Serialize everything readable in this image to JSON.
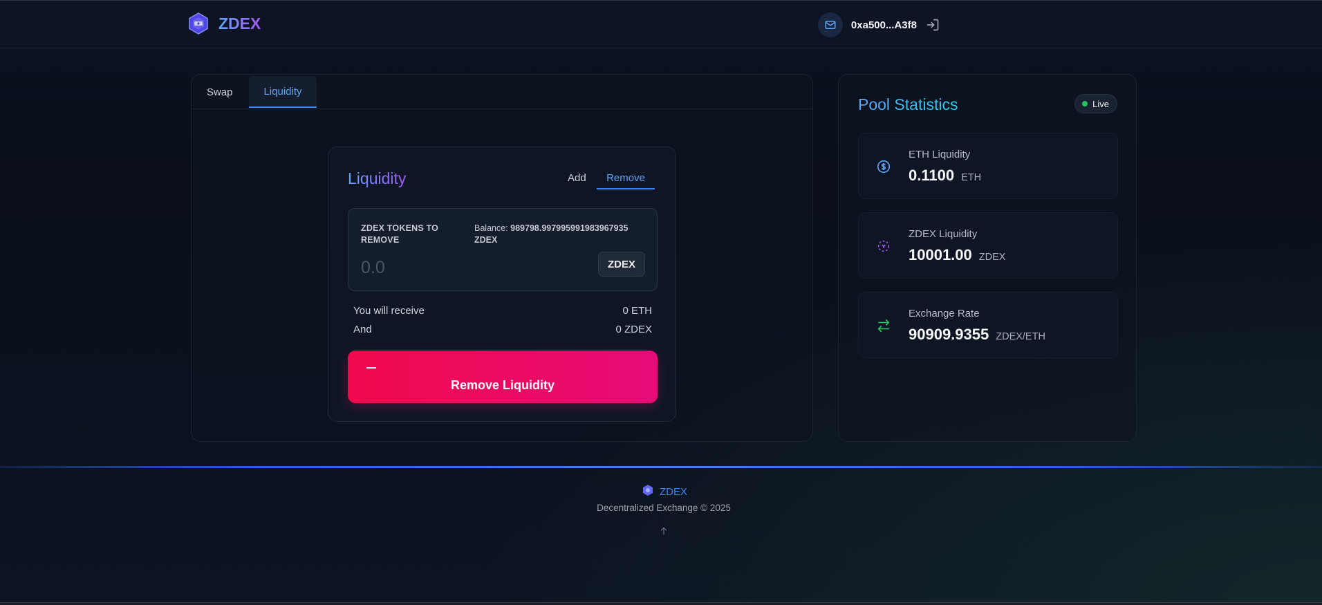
{
  "header": {
    "brand": "ZDEX",
    "wallet_address": "0xa500...A3f8",
    "icons": {
      "logo": "zdex-logo-icon",
      "wallet": "mail-icon",
      "logout": "logout-icon"
    }
  },
  "tabs": [
    {
      "label": "Swap",
      "active": false
    },
    {
      "label": "Liquidity",
      "active": true
    }
  ],
  "liquidity": {
    "title": "Liquidity",
    "mode_add": "Add",
    "mode_remove": "Remove",
    "active_mode": "Remove",
    "input": {
      "label": "ZDEX TOKENS TO REMOVE",
      "balance_prefix": "Balance:",
      "balance_value": "989798.997995991983967935",
      "balance_unit": "ZDEX",
      "placeholder": "0.0",
      "value": "",
      "token": "ZDEX"
    },
    "receive_label": "You will receive",
    "receive_eth": "0 ETH",
    "and_label": "And",
    "receive_zdex": "0 ZDEX",
    "button_label": "Remove Liquidity"
  },
  "stats": {
    "title": "Pool Statistics",
    "live_label": "Live",
    "items": [
      {
        "label": "ETH Liquidity",
        "value": "0.1100",
        "unit": "ETH",
        "icon": "dollar-circle-icon",
        "color": "#60a5fa"
      },
      {
        "label": "ZDEX Liquidity",
        "value": "10001.00",
        "unit": "ZDEX",
        "icon": "token-circle-icon",
        "color": "#a855f7"
      },
      {
        "label": "Exchange Rate",
        "value": "90909.9355",
        "unit": "ZDEX/ETH",
        "icon": "swap-arrows-icon",
        "color": "#22c55e"
      }
    ]
  },
  "footer": {
    "brand": "ZDEX",
    "copyright": "Decentralized Exchange © 2025",
    "back_to_top_icon": "arrow-up-icon"
  },
  "colors": {
    "accent_blue": "#3b82f6",
    "accent_purple": "#a855f7",
    "remove_button": "#f0094b",
    "live_dot": "#22c55e"
  }
}
